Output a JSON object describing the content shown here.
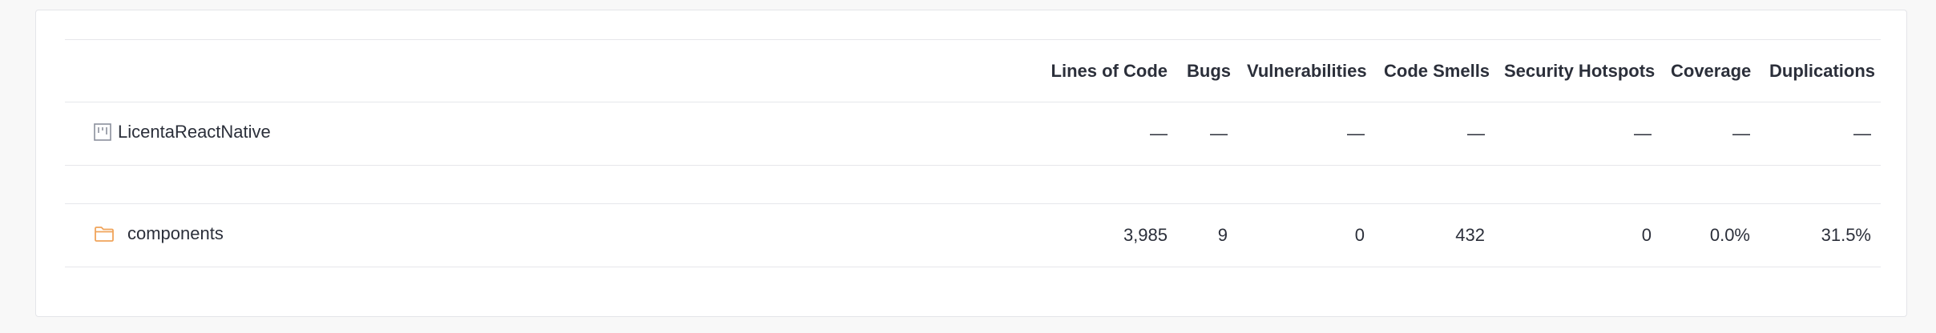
{
  "columns": {
    "lines_of_code": "Lines of Code",
    "bugs": "Bugs",
    "vulnerabilities": "Vulnerabilities",
    "code_smells": "Code Smells",
    "security_hotspots": "Security Hotspots",
    "coverage": "Coverage",
    "duplications": "Duplications"
  },
  "project": {
    "name": "LicentaReactNative",
    "icon": "project-icon",
    "lines_of_code": "—",
    "bugs": "—",
    "vulnerabilities": "—",
    "code_smells": "—",
    "security_hotspots": "—",
    "coverage": "—",
    "duplications": "—"
  },
  "rows": [
    {
      "name": "components",
      "icon": "folder-icon",
      "lines_of_code": "3,985",
      "bugs": "9",
      "vulnerabilities": "0",
      "code_smells": "432",
      "security_hotspots": "0",
      "coverage": "0.0%",
      "duplications": "31.5%"
    }
  ],
  "colors": {
    "folder": "#f0a45a",
    "project_icon": "#8a8f9c",
    "border": "#e6e7eb",
    "text": "#2b2f3a"
  }
}
